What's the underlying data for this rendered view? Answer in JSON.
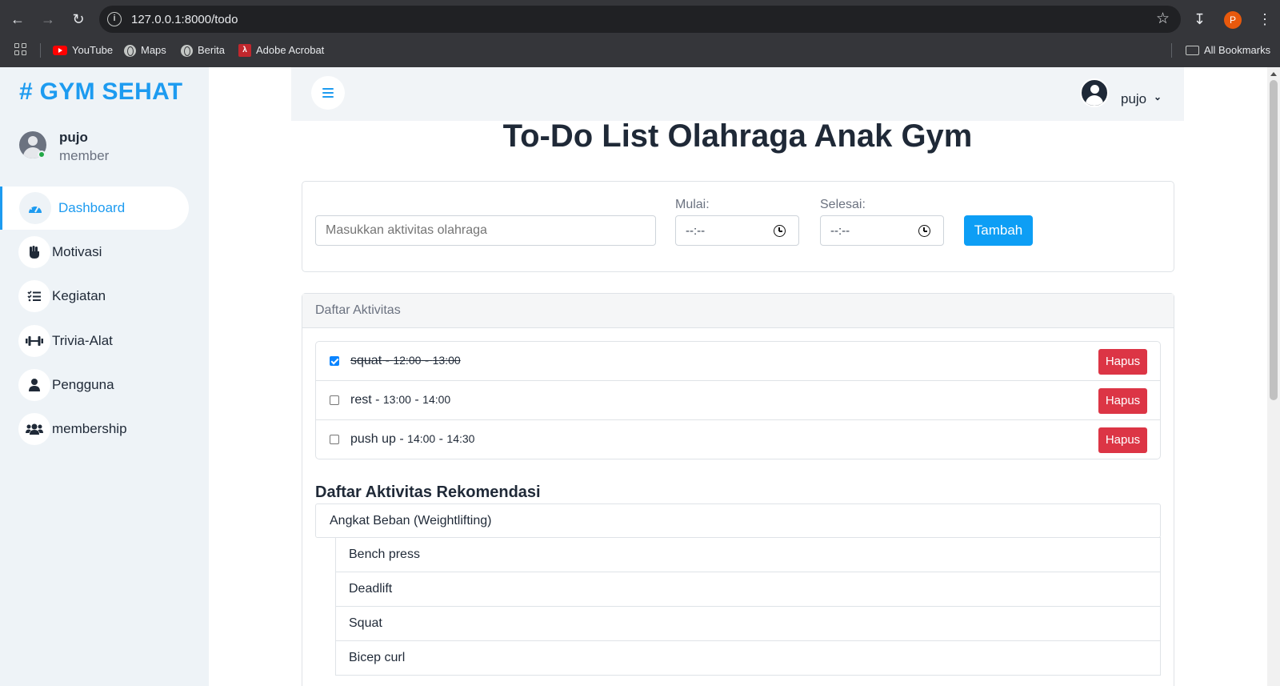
{
  "browser": {
    "url": "127.0.0.1:8000/todo",
    "profile_initial": "P",
    "bookmarks": [
      {
        "label": "YouTube",
        "icon": "youtube-icon"
      },
      {
        "label": "Maps",
        "icon": "globe-icon"
      },
      {
        "label": "Berita",
        "icon": "globe-icon"
      },
      {
        "label": "Adobe Acrobat",
        "icon": "pdf-icon"
      }
    ],
    "all_bookmarks": "All Bookmarks"
  },
  "sidebar": {
    "brand": "# GYM SEHAT",
    "user": {
      "name": "pujo",
      "role": "member"
    },
    "items": [
      {
        "label": "Dashboard",
        "icon": "gauge-icon",
        "active": true
      },
      {
        "label": "Motivasi",
        "icon": "fist-icon"
      },
      {
        "label": "Kegiatan",
        "icon": "list-check-icon"
      },
      {
        "label": "Trivia-Alat",
        "icon": "dumbbell-icon"
      },
      {
        "label": "Pengguna",
        "icon": "user-icon"
      },
      {
        "label": "membership",
        "icon": "users-icon"
      }
    ]
  },
  "topbar": {
    "user_name": "pujo"
  },
  "page": {
    "title": "To-Do List Olahraga Anak Gym"
  },
  "form": {
    "activity_placeholder": "Masukkan aktivitas olahraga",
    "start_label": "Mulai:",
    "start_value": "--:--",
    "end_label": "Selesai:",
    "end_value": "--:--",
    "submit_label": "Tambah"
  },
  "list": {
    "header": "Daftar Aktivitas",
    "delete_label": "Hapus",
    "items": [
      {
        "name": "squat",
        "start": "12:00",
        "end": "13:00",
        "done": true
      },
      {
        "name": "rest",
        "start": "13:00",
        "end": "14:00",
        "done": false
      },
      {
        "name": "push up",
        "start": "14:00",
        "end": "14:30",
        "done": false
      }
    ]
  },
  "recommendations": {
    "title": "Daftar Aktivitas Rekomendasi",
    "category": "Angkat Beban (Weightlifting)",
    "exercises": [
      "Bench press",
      "Deadlift",
      "Squat",
      "Bicep curl"
    ]
  },
  "colors": {
    "accent": "#1d9bf0",
    "primary_button": "#0d9ef5",
    "danger": "#dc3545",
    "sidebar_bg": "#eef3f7"
  }
}
